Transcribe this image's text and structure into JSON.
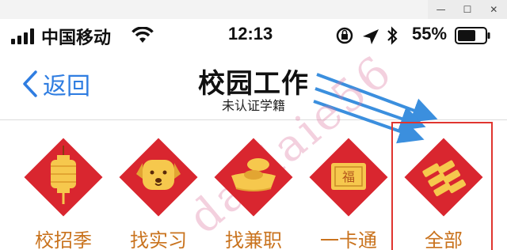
{
  "status_bar": {
    "carrier": "中国移动",
    "time": "12:13",
    "battery_percent": "55%"
  },
  "nav": {
    "back_label": "返回",
    "title": "校园工作",
    "subtitle": "未认证学籍"
  },
  "grid": {
    "items": [
      {
        "label": "校招季",
        "icon": "lantern-icon"
      },
      {
        "label": "找实习",
        "icon": "dog-icon"
      },
      {
        "label": "找兼职",
        "icon": "gold-ingot-icon"
      },
      {
        "label": "一卡通",
        "icon": "fu-card-icon"
      },
      {
        "label": "全部",
        "icon": "firecracker-icon"
      }
    ]
  },
  "watermark": "daidaie56",
  "colors": {
    "diamond": "#d9262f",
    "gold": "#f6c84d",
    "label": "#c9731e",
    "back": "#2f7de1",
    "highlight_border": "#e0352f",
    "arrow": "#3b8fde"
  }
}
